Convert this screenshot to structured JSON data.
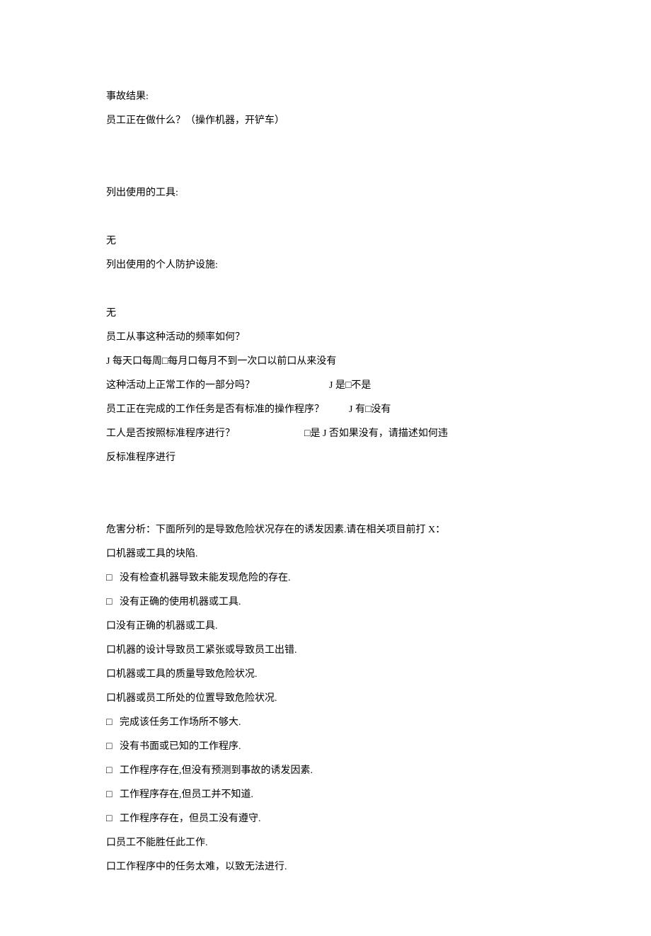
{
  "lines": {
    "l1": "事故结果:",
    "l2": "员工正在做什么？（操作机器，开铲车）",
    "l3": "列出使用的工具:",
    "l4": "无",
    "l5": "列出使用的个人防护设施:",
    "l6": "无",
    "l7": "员工从事这种活动的频率如何？",
    "l8": "J 每天口每周□每月口每月不到一次口以前口从来没有",
    "l9_left": "这种活动上正常工作的一部分吗？",
    "l9_right": "J 是□不是",
    "l10_left": "员工正在完成的工作任务是否有标准的操作程序？",
    "l10_right": "J 有□没有",
    "l11_left": "工人是否按照标准程序进行？",
    "l11_right": "□是 J 否如果没有，请描述如何违",
    "l12": "反标准程序进行",
    "hazard_header": "危害分析：下面所列的是导致危险状况存在的诱发因素.请在相关项目前打 X：",
    "h1": "口机器或工具的块陷.",
    "h2": "□   没有检查机器导致未能发现危险的存在.",
    "h3": "□   没有正确的使用机器或工具.",
    "h4": "口没有正确的机器或工具.",
    "h5": "口机器的设计导致员工紧张或导致员工出错.",
    "h6": "口机器或工具的质量导致危险状况.",
    "h7": "口机器或员工所处的位置导致危险状况.",
    "h8": "□   完成该任务工作场所不够大.",
    "h9": "□   没有书面或已知的工作程序.",
    "h10": "□   工作程序存在,但没有预测到事故的诱发因素.",
    "h11": "□   工作程序存在,但员工并不知道.",
    "h12": "□   工作程序存在，但员工没有遵守.",
    "h13": "口员工不能胜任此工作.",
    "h14": "口工作程序中的任务太难，以致无法进行."
  }
}
